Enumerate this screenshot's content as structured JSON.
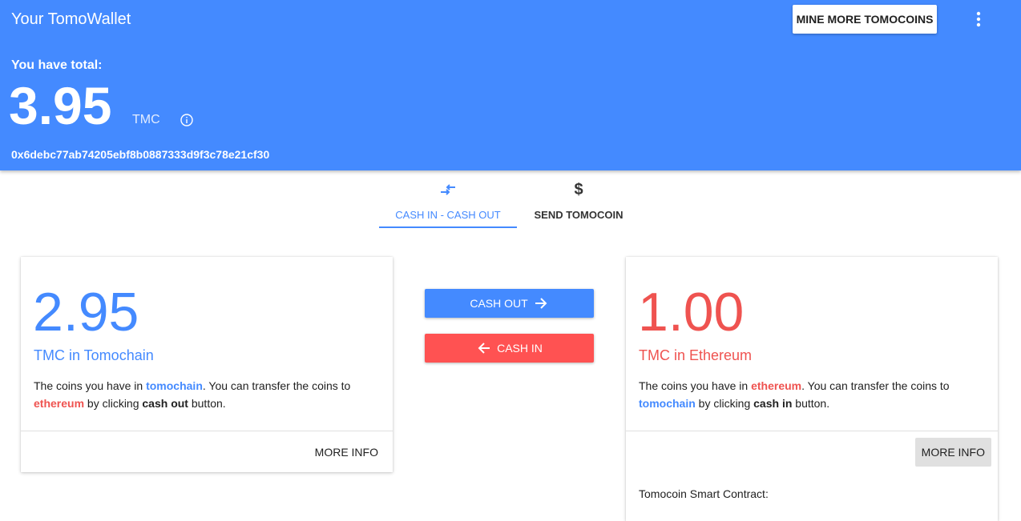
{
  "header": {
    "app_title": "Your TomoWallet",
    "mine_button": "MINE MORE TOMOCOINS",
    "menu_icon": "more-vert-icon",
    "total_label": "You have total:",
    "total_amount": "3.95",
    "total_unit": "TMC",
    "info_icon": "info-icon",
    "address": "0x6debc77ab74205ebf8b0887333d9f3c78e21cf30"
  },
  "tabs": [
    {
      "label": "CASH IN - CASH OUT",
      "icon": "swap-arrows-icon",
      "active": true
    },
    {
      "label": "SEND TOMOCOIN",
      "icon": "dollar-icon",
      "active": false
    }
  ],
  "tomochain_card": {
    "amount": "2.95",
    "subtitle": "TMC in Tomochain",
    "desc_1": "The coins you have in ",
    "desc_hl_1": "tomochain",
    "desc_2": ". You can transfer the coins to ",
    "desc_hl_2": "ethereum",
    "desc_3": " by clicking ",
    "desc_bold": "cash out",
    "desc_4": " button.",
    "more_info": "MORE INFO"
  },
  "ethereum_card": {
    "amount": "1.00",
    "subtitle": "TMC in Ethereum",
    "desc_1": "The coins you have in ",
    "desc_hl_1": "ethereum",
    "desc_2": ". You can transfer the coins to ",
    "desc_hl_2": "tomochain",
    "desc_3": " by clicking ",
    "desc_bold": "cash in",
    "desc_4": " button.",
    "more_info": "MORE INFO",
    "contract_label": "Tomocoin Smart Contract:"
  },
  "actions": {
    "cash_out": "CASH OUT",
    "cash_in": "CASH IN"
  },
  "colors": {
    "primary": "#448aff",
    "accent_red": "#ff5252",
    "text_red": "#ef5350"
  }
}
